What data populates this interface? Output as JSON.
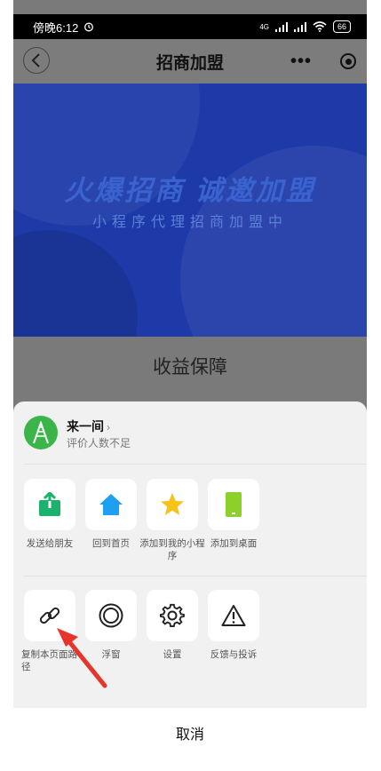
{
  "status_bar": {
    "time": "傍晚6:12",
    "network_1": "4G",
    "network_2": "4G",
    "battery": "66"
  },
  "nav": {
    "title": "招商加盟",
    "more_label": "•••"
  },
  "banner": {
    "title": "火爆招商  诚邀加盟",
    "subtitle": "小程序代理招商加盟中"
  },
  "section": {
    "title": "收益保障"
  },
  "sheet": {
    "app_name": "来一间",
    "app_chevron": "›",
    "app_rating": "评价人数不足",
    "row1": [
      {
        "label": "发送给朋友",
        "icon": "share-icon",
        "color": "#1bb36b"
      },
      {
        "label": "回到首页",
        "icon": "home-icon",
        "color": "#1e9ff2"
      },
      {
        "label": "添加到我的小程序",
        "icon": "star-icon",
        "color": "#f7c21a"
      },
      {
        "label": "添加到桌面",
        "icon": "phone-icon",
        "color": "#8bd12a"
      }
    ],
    "row2": [
      {
        "label": "复制本页面路径",
        "icon": "link-icon",
        "color": "#222222"
      },
      {
        "label": "浮窗",
        "icon": "float-window-icon",
        "color": "#222222"
      },
      {
        "label": "设置",
        "icon": "gear-icon",
        "color": "#222222"
      },
      {
        "label": "反馈与投诉",
        "icon": "warning-icon",
        "color": "#222222"
      }
    ],
    "cancel_label": "取消"
  },
  "annotation": {
    "arrow_color": "#e8352b"
  }
}
